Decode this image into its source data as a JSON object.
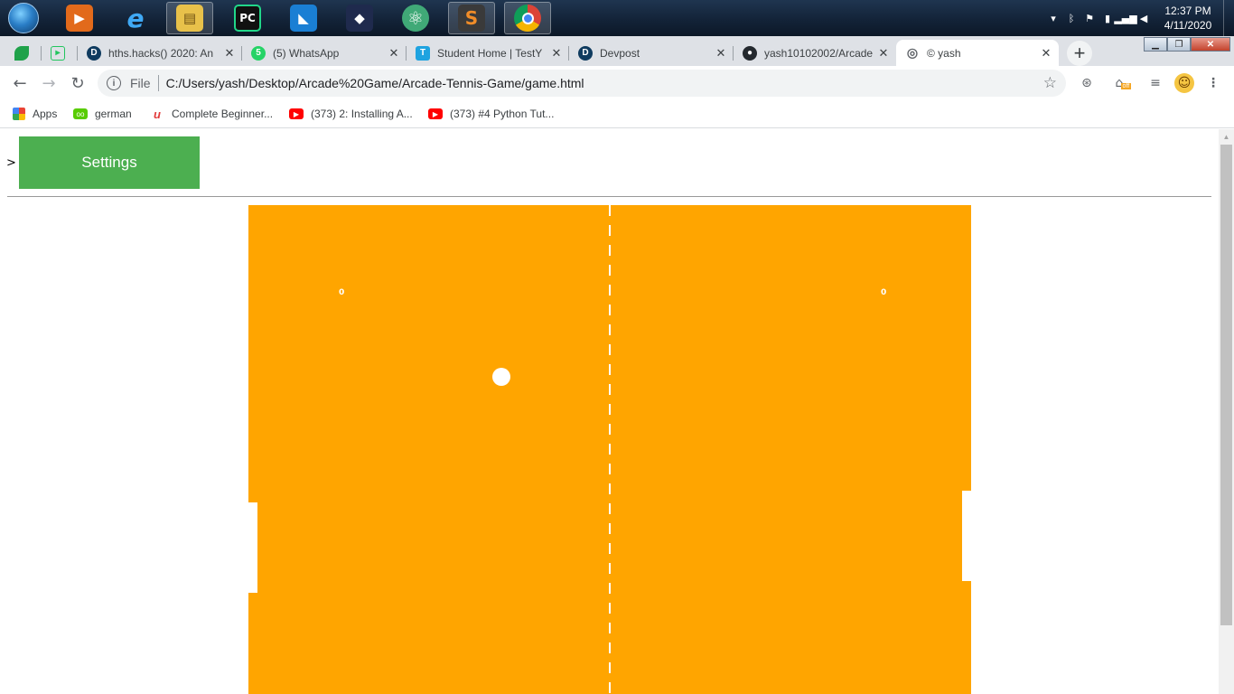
{
  "taskbar": {
    "apps": [
      {
        "name": "media-player-icon",
        "glyph": "▶",
        "color": "#e26a1b"
      },
      {
        "name": "internet-explorer-icon",
        "glyph": "e",
        "color": "#1f8fe0"
      },
      {
        "name": "file-explorer-icon",
        "glyph": "▤",
        "color": "#e8c14a"
      },
      {
        "name": "pycharm-icon",
        "glyph": "PC",
        "color": "#1a1a1a"
      },
      {
        "name": "vscode-icon",
        "glyph": "◣",
        "color": "#1a7fd4"
      },
      {
        "name": "visual-studio-icon",
        "glyph": "◆",
        "color": "#5c2d91"
      },
      {
        "name": "atom-icon",
        "glyph": "⚛",
        "color": "#40a977"
      },
      {
        "name": "sublime-text-icon",
        "glyph": "S",
        "color": "#f08c28"
      },
      {
        "name": "chrome-icon",
        "glyph": "●",
        "color": "#3b82f6"
      }
    ],
    "clock_time": "12:37 PM",
    "clock_date": "4/11/2020"
  },
  "tabs": [
    {
      "title": "",
      "fav_color": "#1fa24a",
      "fav_text": "",
      "close": ""
    },
    {
      "title": "",
      "fav_color": "#22c55e",
      "fav_text": "",
      "close": ""
    },
    {
      "title": "hths.hacks() 2020: An",
      "fav_color": "#0f3b5f",
      "fav_text": "D",
      "close": "✕"
    },
    {
      "title": "(5) WhatsApp",
      "fav_color": "#25d366",
      "fav_text": "5",
      "close": "✕"
    },
    {
      "title": "Student Home | TestY",
      "fav_color": "#1ea3e0",
      "fav_text": "T",
      "close": "✕"
    },
    {
      "title": "Devpost",
      "fav_color": "#0f3b5f",
      "fav_text": "D",
      "close": "✕"
    },
    {
      "title": "yash10102002/Arcade",
      "fav_color": "#24292e",
      "fav_text": "●",
      "close": "✕"
    },
    {
      "title": "© yash",
      "fav_color": "#5f6368",
      "fav_text": "◎",
      "close": "✕"
    }
  ],
  "toolbar": {
    "scheme": "File",
    "url": "C:/Users/yash/Desktop/Arcade%20Game/Arcade-Tennis-Game/game.html",
    "profile_badge": "off"
  },
  "bookmarks": [
    {
      "label": "Apps",
      "color": "#4285f4"
    },
    {
      "label": "german",
      "color": "#58cc02"
    },
    {
      "label": "Complete Beginner...",
      "color": "#e23b3b"
    },
    {
      "label": "(373) 2: Installing A...",
      "color": "#ff0000"
    },
    {
      "label": "(373) #4 Python Tut...",
      "color": "#ff0000"
    }
  ],
  "page": {
    "prompt": ">",
    "settings_label": "Settings"
  },
  "game": {
    "background": "#ffa500",
    "left_score": "0",
    "right_score": "0"
  }
}
